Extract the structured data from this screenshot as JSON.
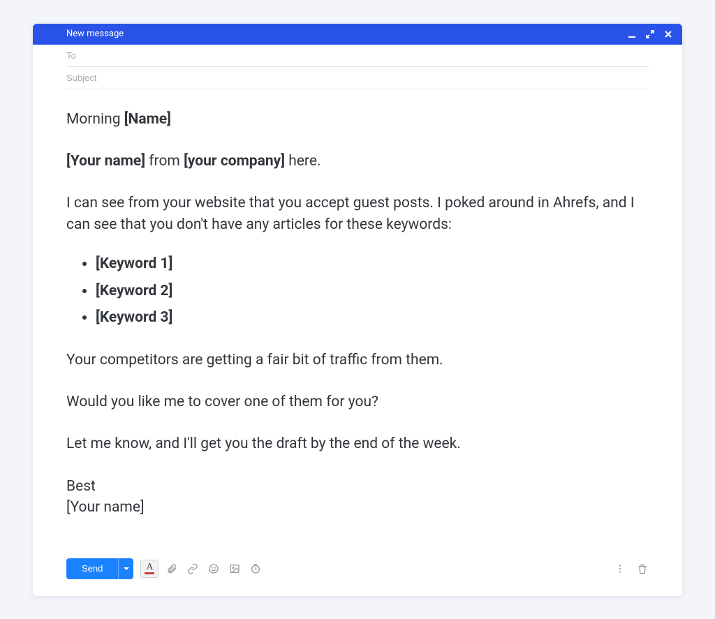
{
  "header": {
    "title": "New message"
  },
  "fields": {
    "to_placeholder": "To",
    "subject_placeholder": "Subject"
  },
  "body": {
    "greet_prefix": "Morning ",
    "greet_name": "[Name]",
    "intro_yourname": "[Your name]",
    "intro_from": " from ",
    "intro_company": "[your company]",
    "intro_here": " here.",
    "para_observation": "I can see from your website that you accept guest posts. I poked around in Ahrefs, and I can see that you don't have any articles for these keywords:",
    "keywords": [
      "[Keyword 1]",
      "[Keyword 2]",
      "[Keyword 3]"
    ],
    "para_competitors": "Your competitors are getting a fair bit of traffic from them.",
    "para_offer": "Would you like me to cover one of them for you?",
    "para_close": "Let me know, and I'll get you the draft by the end of the week.",
    "signoff": "Best",
    "signature": "[Your name]"
  },
  "toolbar": {
    "send_label": "Send"
  }
}
